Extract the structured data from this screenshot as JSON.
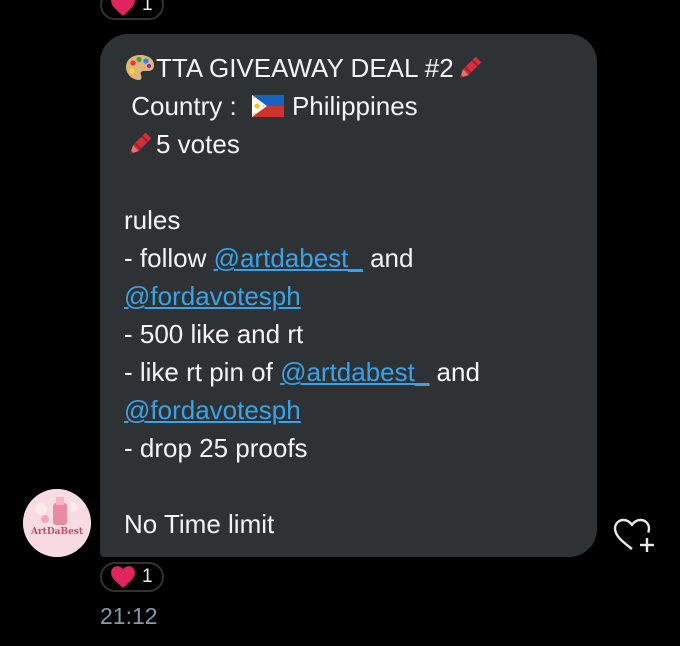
{
  "reactions": {
    "top": {
      "icon": "heart-icon",
      "count": "1",
      "color": "#e0245e"
    },
    "bottom": {
      "icon": "heart-icon",
      "count": "1",
      "color": "#e0245e"
    }
  },
  "message": {
    "line1": {
      "icon_start": "palette-icon",
      "text": "TTA GIVEAWAY DEAL #2",
      "icon_end": "crayon-icon"
    },
    "line2": {
      "text": " Country : ",
      "flag": "philippines-flag-icon",
      "country": "Philippines"
    },
    "line3": {
      "icon_start": "crayon-icon",
      "text": "5 votes"
    },
    "rules_title": "rules",
    "rule1": {
      "prefix": "- follow ",
      "mention1": "@artdabest_",
      "mid": " and",
      "mention2": "@fordavotesph"
    },
    "rule2": "- 500 like and rt",
    "rule3": {
      "prefix": "- like rt pin of ",
      "mention1": "@artdabest_",
      "mid": " and",
      "mention2": "@fordavotesph"
    },
    "rule4": "- drop 25 proofs",
    "footer": "No Time limit"
  },
  "sender": {
    "avatar_label": "ArtDaBest"
  },
  "add_reaction": {
    "icon": "heart-plus-icon"
  },
  "timestamp": "21:12",
  "colors": {
    "bubble": "#2f3235",
    "mention": "#3aa3e8",
    "background": "#000000"
  }
}
